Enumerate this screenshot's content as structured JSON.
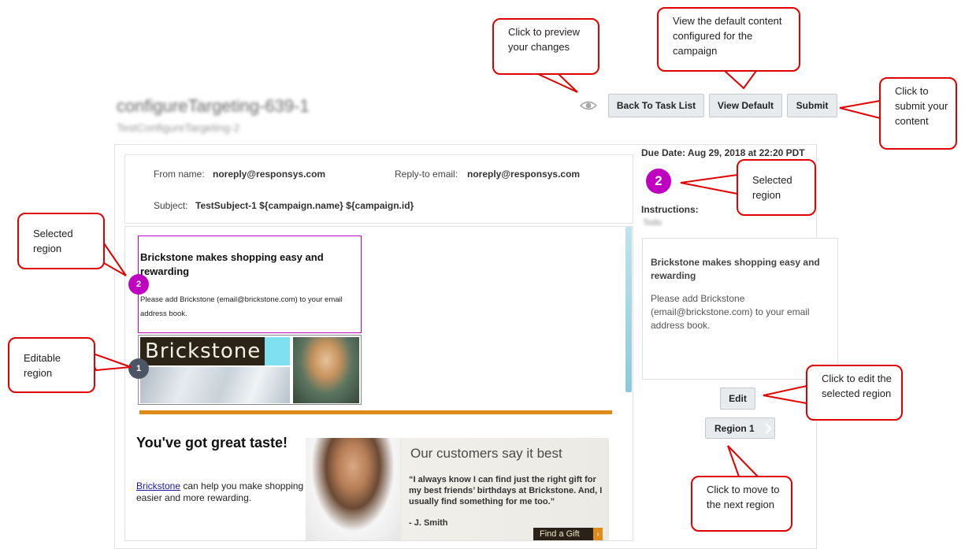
{
  "header": {
    "title": "configureTargeting-639-1",
    "subtitle": "TestConfigureTargeting-2"
  },
  "toolbar": {
    "preview_icon": "eye-icon",
    "back_label": "Back To Task List",
    "view_default_label": "View Default",
    "submit_label": "Submit"
  },
  "email_header": {
    "from_label": "From name:",
    "from_value": "noreply@responsys.com",
    "reply_label": "Reply-to email:",
    "reply_value": "noreply@responsys.com",
    "subject_label": "Subject:",
    "subject_value": "TestSubject-1 ${campaign.name} ${campaign.id}"
  },
  "email_body": {
    "region2_title": "Brickstone makes shopping easy and rewarding",
    "region2_text": "Please add Brickstone (email@brickstone.com) to your email address book.",
    "region2_number": "2",
    "region1_number": "1",
    "logo_text": "Brickstone",
    "taste_title": "You've got great taste!",
    "taste_link": "Brickstone",
    "taste_text": " can help you make shopping easier and more rewarding.",
    "testimonial_title": "Our customers say it best",
    "testimonial_quote": "“I always know I can find just the right gift for my best friends’ birthdays at Brickstone. And, I usually find something for me too.”",
    "testimonial_author": "- J. Smith",
    "find_gift": "Find a Gift",
    "find_gift_arrow": "›"
  },
  "side_panel": {
    "due_date": "Due Date: Aug 29, 2018 at 22:20 PDT",
    "selected_number": "2",
    "instructions_label": "Instructions:",
    "instructions_value": "Todo",
    "preview_title": "Brickstone makes shopping easy and rewarding",
    "preview_text": "Please add Brickstone (email@brickstone.com) to your email address book.",
    "edit_label": "Edit",
    "region_label": "Region 1",
    "region_next_icon": "chevron-right-icon"
  },
  "callouts": {
    "preview": "Click to preview your changes",
    "view_default": "View the default content configured for the campaign",
    "submit": "Click to submit your content",
    "selected_region_right": "Selected region",
    "selected_region_left": "Selected region",
    "editable_region": "Editable region",
    "edit": "Click to edit the selected region",
    "next_region": "Click to move to the next region"
  },
  "colors": {
    "callout_border": "#e00000",
    "selected_region": "#c000c0",
    "editable_badge": "#4c5566",
    "accent_rule": "#dd8a18"
  }
}
